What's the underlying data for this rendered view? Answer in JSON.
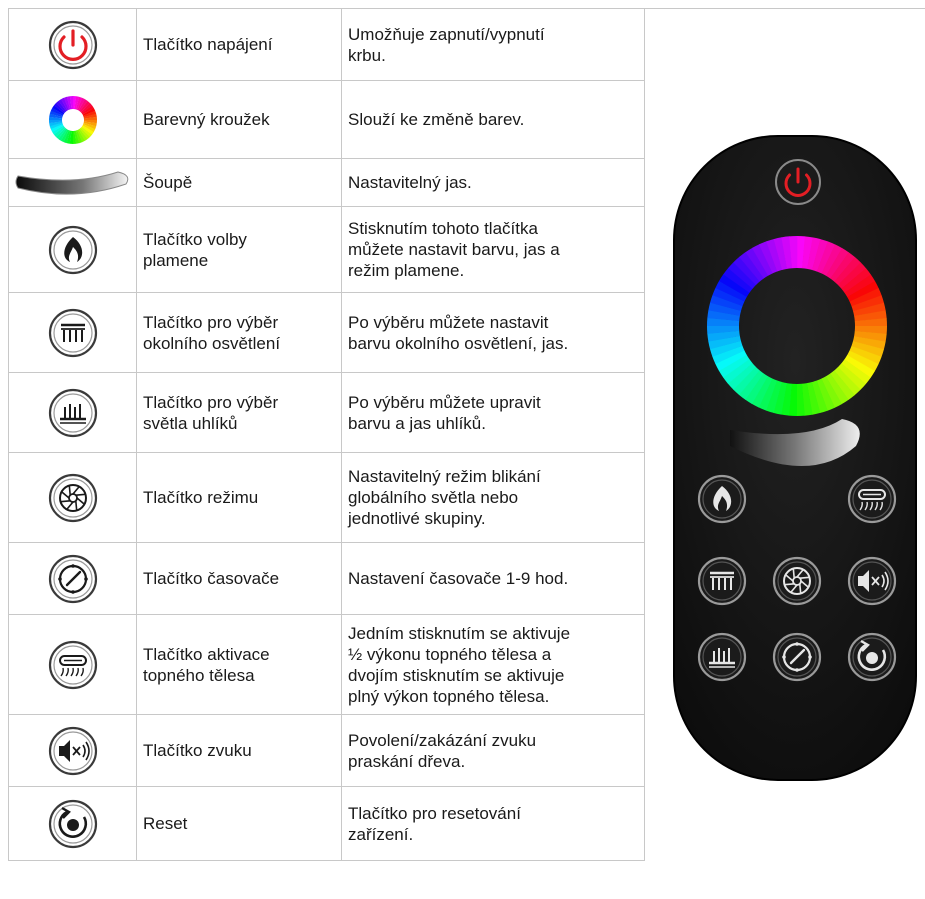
{
  "rows": [
    {
      "icon": "power-icon",
      "name": "Tlačítko napájení",
      "desc": "Umožňuje zapnutí/vypnutí\nkrbu."
    },
    {
      "icon": "color-ring-icon",
      "name": "Barevný kroužek",
      "desc": "Slouží ke změně barev."
    },
    {
      "icon": "slider-icon",
      "name": "Šoupě",
      "desc": "Nastavitelný jas."
    },
    {
      "icon": "flame-icon",
      "name": "Tlačítko volby\nplamene",
      "desc": "Stisknutím tohoto tlačítka\nmůžete nastavit barvu, jas a\nrežim plamene."
    },
    {
      "icon": "ambient-light-icon",
      "name": "Tlačítko pro výběr\nokolního osvětlení",
      "desc": "Po výběru můžete nastavit\nbarvu okolního osvětlení, jas."
    },
    {
      "icon": "ember-light-icon",
      "name": "Tlačítko pro výběr\nsvětla uhlíků",
      "desc": "Po výběru můžete upravit\nbarvu a jas uhlíků."
    },
    {
      "icon": "mode-wheel-icon",
      "name": "Tlačítko režimu",
      "desc": "Nastavitelný režim blikání\nglobálního světla nebo\njednotlivé skupiny."
    },
    {
      "icon": "timer-icon",
      "name": "Tlačítko časovače",
      "desc": "Nastavení časovače 1-9 hod."
    },
    {
      "icon": "heater-icon",
      "name": "Tlačítko aktivace\ntopného tělesa",
      "desc": "Jedním stisknutím se aktivuje\n½ výkonu topného tělesa a\ndvojím stisknutím se aktivuje\nplný výkon topného tělesa."
    },
    {
      "icon": "sound-icon",
      "name": "Tlačítko zvuku",
      "desc": "Povolení/zakázání zvuku\npraskání dřeva."
    },
    {
      "icon": "reset-icon",
      "name": "Reset",
      "desc": "Tlačítko pro resetování\nzařízení."
    }
  ],
  "colors": {
    "power_red": "#e31e24",
    "remote_body": "#161616",
    "border": "#c8c8c8"
  }
}
